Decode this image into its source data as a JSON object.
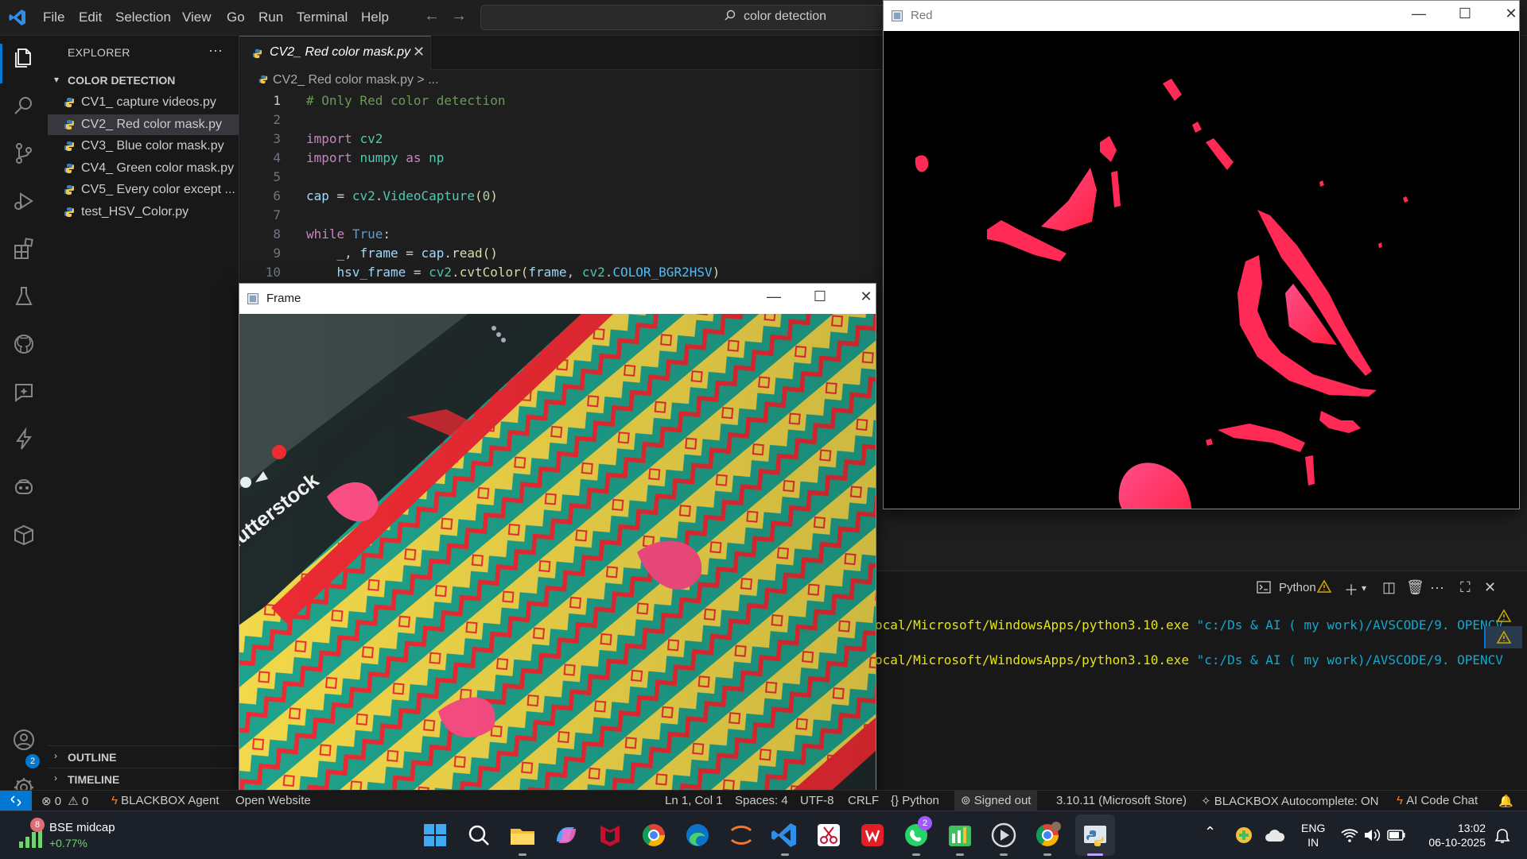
{
  "titlebar": {
    "menus": [
      "File",
      "Edit",
      "Selection",
      "View",
      "Go",
      "Run",
      "Terminal",
      "Help"
    ],
    "search_text": "color detection"
  },
  "sidebar": {
    "title": "EXPLORER",
    "more": "···",
    "folder": "COLOR DETECTION",
    "files": [
      {
        "name": "CV1_ capture videos.py",
        "selected": false
      },
      {
        "name": "CV2_ Red color mask.py",
        "selected": true
      },
      {
        "name": "CV3_ Blue color mask.py",
        "selected": false
      },
      {
        "name": "CV4_ Green color mask.py",
        "selected": false
      },
      {
        "name": "CV5_ Every color except ...",
        "selected": false
      },
      {
        "name": "test_HSV_Color.py",
        "selected": false
      }
    ],
    "outline": "OUTLINE",
    "timeline": "TIMELINE",
    "accounts_badge": "2"
  },
  "editor": {
    "tab_label": "CV2_ Red color mask.py",
    "breadcrumb": "CV2_ Red color mask.py > ...",
    "lines": [
      {
        "n": "1"
      },
      {
        "n": "2"
      },
      {
        "n": "3"
      },
      {
        "n": "4"
      },
      {
        "n": "5"
      },
      {
        "n": "6"
      },
      {
        "n": "7"
      },
      {
        "n": "8"
      },
      {
        "n": "9"
      },
      {
        "n": "10"
      }
    ],
    "code": {
      "l1": "# Only Red color detection",
      "l3_kw": "import",
      "l3_mod": "cv2",
      "l4_kw": "import",
      "l4_mod": "numpy",
      "l4_as": "as",
      "l4_alias": "np",
      "l6_var": "cap",
      "l6_eq": " = ",
      "l6_mod": "cv2",
      "l6_dot": ".",
      "l6_fn": "VideoCapture",
      "l6_open": "(",
      "l6_num": "0",
      "l6_close": ")",
      "l8_kw": "while",
      "l8_true": "True",
      "l8_colon": ":",
      "l9_lead": "    _, ",
      "l9_var": "frame",
      "l9_eq": " = ",
      "l9_obj": "cap",
      "l9_dot": ".",
      "l9_fn": "read",
      "l9_paren": "()",
      "l10_lead": "    ",
      "l10_var": "hsv_frame",
      "l10_eq": " = ",
      "l10_mod": "cv2",
      "l10_dot": ".",
      "l10_fn": "cvtColor",
      "l10_open": "(",
      "l10_arg": "frame",
      "l10_sep": ", ",
      "l10_mod2": "cv2",
      "l10_dot2": ".",
      "l10_const": "COLOR_BGR2HSV",
      "l10_close": ")"
    }
  },
  "windows": {
    "frame_title": "Frame",
    "red_title": "Red",
    "watermark": "hutterstock"
  },
  "panel": {
    "terminal_label": "Python",
    "term_lines": [
      {
        "prefix": "ocal/Microsoft/WindowsApps/python3.10.exe ",
        "path": "\"c:/Ds & AI ( my work)/AVSCODE/9. OPENCV"
      },
      {
        "prefix": "ocal/Microsoft/WindowsApps/python3.10.exe ",
        "path": "\"c:/Ds & AI ( my work)/AVSCODE/9. OPENCV"
      }
    ]
  },
  "statusbar": {
    "errors": "0",
    "warnings": "0",
    "blackbox_agent": "BLACKBOX Agent",
    "open_website": "Open Website",
    "cursor": "Ln 1, Col 1",
    "spaces": "Spaces: 4",
    "encoding": "UTF-8",
    "eol": "CRLF",
    "language": "Python",
    "signed_out": "Signed out",
    "interpreter": "3.10.11 (Microsoft Store)",
    "autocomplete": "BLACKBOX Autocomplete: ON",
    "ai_chat": "AI Code Chat"
  },
  "taskbar": {
    "widget_title": "BSE midcap",
    "widget_change": "+0.77%",
    "widget_badge": "8",
    "whatsapp_badge": "2",
    "lang_top": "ENG",
    "lang_bottom": "IN",
    "time": "13:02",
    "date": "06-10-2025"
  },
  "colors": {
    "accent": "#0078d4",
    "mask_red": "#ff2a55",
    "pattern_yellow": "#f2d84a",
    "pattern_teal": "#1fa38c",
    "pattern_red": "#ee2b34"
  }
}
